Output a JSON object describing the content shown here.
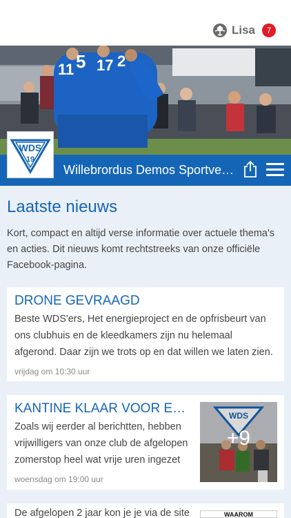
{
  "header": {
    "user_icon": "football-icon",
    "user_name": "Lisa",
    "notification_count": "7",
    "brand_color": "#1565b6",
    "badge_color": "#e21b24"
  },
  "club": {
    "logo_text": "WDS",
    "logo_subtext": "19",
    "name": "Willebrordus Demos Sportvereniging"
  },
  "news": {
    "title": "Laatste nieuws",
    "intro": "Kort, compact en altijd verse informatie over actuele thema's en acties. Dit nieuws komt rechtstreeks van onze officiële Facebook-pagina.",
    "items": [
      {
        "title": "DRONE GEVRAAGD",
        "body": "Beste WDS'ers, Het energieproject en de opfrisbeurt van ons clubhuis en de kleedkamers zijn nu helemaal afgerond. Daar zijn we trots op en dat willen we laten zien. Daarom zijn we",
        "time": "vrijdag om 10:30 uur"
      },
      {
        "title": "KANTINE KLAAR VOOR EEN NIEUW SEIZOEN",
        "body": "Zoals wij eerder al berichtten, hebben vrijwilligers van onze club de afgelopen zomerstop heel wat vrije uren ingezet om",
        "time": "woensdag om 19:00 uur",
        "photo_count": "+9"
      },
      {
        "body": "De afgelopen 2 jaar kon je je via de site",
        "thumb_text": "WAAROM"
      }
    ]
  }
}
